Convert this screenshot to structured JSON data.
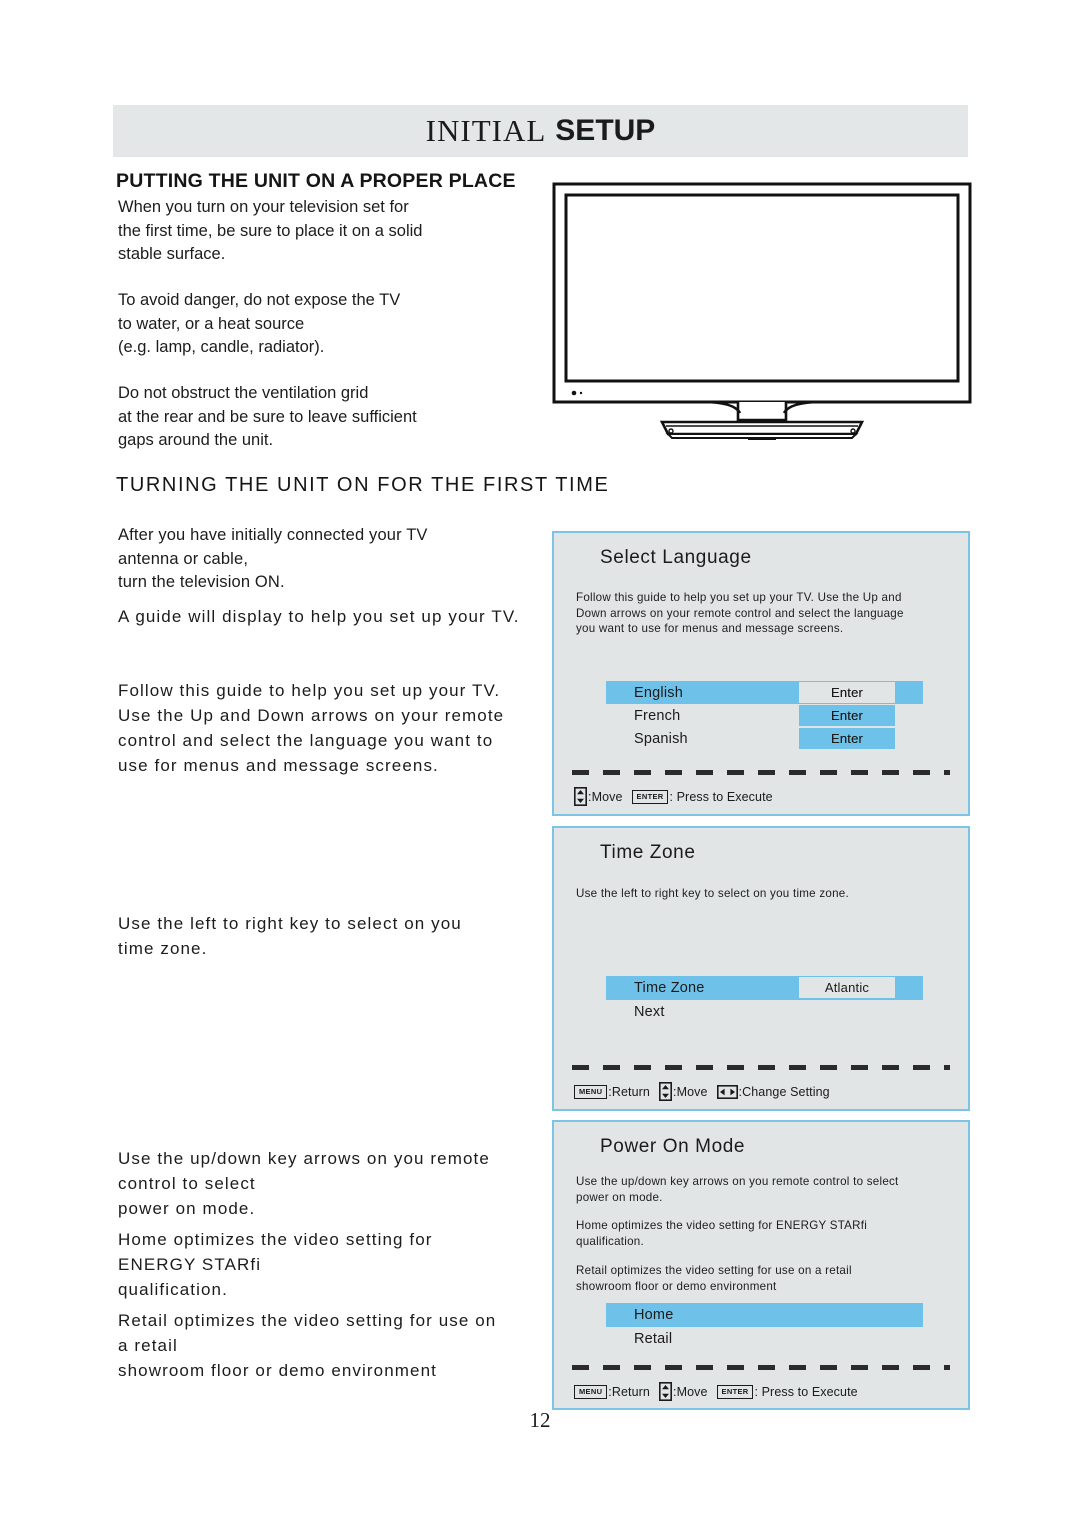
{
  "header": {
    "title_light": "INITIAL",
    "title_bold": "SETUP"
  },
  "sections": {
    "putting_heading": "PUTTING THE UNIT ON A PROPER PLACE",
    "turning_heading": "TURNING THE UNIT ON FOR THE FIRST TIME"
  },
  "body": {
    "place_p1": "When you turn on your television set for\nthe first time, be sure to place it on a solid\nstable surface.",
    "place_p2": "To avoid danger, do not expose the TV\nto water, or a heat source\n(e.g. lamp, candle, radiator).",
    "place_p3": "Do not obstruct the ventilation grid\nat the rear and be sure to leave sufficient\ngaps around the unit.",
    "after_connect": "After you have initially connected your TV\nantenna or cable,\nturn the television ON.",
    "guide_display": "A guide will display to help you set up your TV.",
    "follow_guide": "Follow this guide to help you set up your TV.\nUse the Up and Down arrows on your remote\ncontrol and select the language you want to\nuse for menus and message screens.",
    "left_right": "Use the left to right key to select on you\ntime zone.",
    "updown_select": "Use the up/down key arrows on you remote\ncontrol to select\npower on mode.",
    "home_desc": "Home optimizes the video setting for\nENERGY STARfi\nqualification.",
    "retail_desc": "Retail optimizes the video setting for use on\na retail\nshowroom floor or demo environment"
  },
  "osd_language": {
    "title": "Select Language",
    "description": "Follow this guide to help you set up your TV. Use the Up and\nDown arrows on your remote control and select the language\nyou want to use for menus and message screens.",
    "options": [
      {
        "label": "English",
        "value": "Enter",
        "selected": true,
        "value_style": "grey"
      },
      {
        "label": "French",
        "value": "Enter",
        "selected": false,
        "value_style": "blue"
      },
      {
        "label": "Spanish",
        "value": "Enter",
        "selected": false,
        "value_style": "blue"
      }
    ],
    "footer": [
      {
        "icon": "updown-arrows-icon",
        "label": ":Move"
      },
      {
        "key": "ENTER",
        "label": ": Press to Execute"
      }
    ]
  },
  "osd_timezone": {
    "title": "Time Zone",
    "description": "Use the left to right key to select on you time zone.",
    "options": [
      {
        "label": "Time Zone",
        "value": "Atlantic",
        "selected": true,
        "value_style": "grey"
      },
      {
        "label": "Next",
        "value": "",
        "selected": false,
        "value_style": "none"
      }
    ],
    "footer": [
      {
        "key": "MENU",
        "label": ":Return"
      },
      {
        "icon": "updown-arrows-icon",
        "label": ":Move"
      },
      {
        "icon": "leftright-arrows-icon",
        "label": ":Change Setting"
      }
    ]
  },
  "osd_power": {
    "title": "Power On Mode",
    "description_1": "Use the up/down key arrows on you remote control to select\npower on mode.",
    "description_2": "Home optimizes the video setting for ENERGY STARfi\nqualification.",
    "description_3": "Retail optimizes the video setting for use on a retail\nshowroom floor or demo environment",
    "options": [
      {
        "label": "Home",
        "value": "",
        "selected": true,
        "value_style": "none"
      },
      {
        "label": "Retail",
        "value": "",
        "selected": false,
        "value_style": "none"
      }
    ],
    "footer": [
      {
        "key": "MENU",
        "label": ":Return"
      },
      {
        "icon": "updown-arrows-icon",
        "label": ":Move"
      },
      {
        "key": "ENTER",
        "label": ": Press to Execute"
      }
    ]
  },
  "footer": {
    "page_number": "12"
  },
  "colors": {
    "header_band": "#e3e7e7",
    "osd_fill": "#e2e5e5",
    "osd_border": "#7dc4e4",
    "highlight": "#6ec1e8",
    "text": "#1b1b1b"
  }
}
